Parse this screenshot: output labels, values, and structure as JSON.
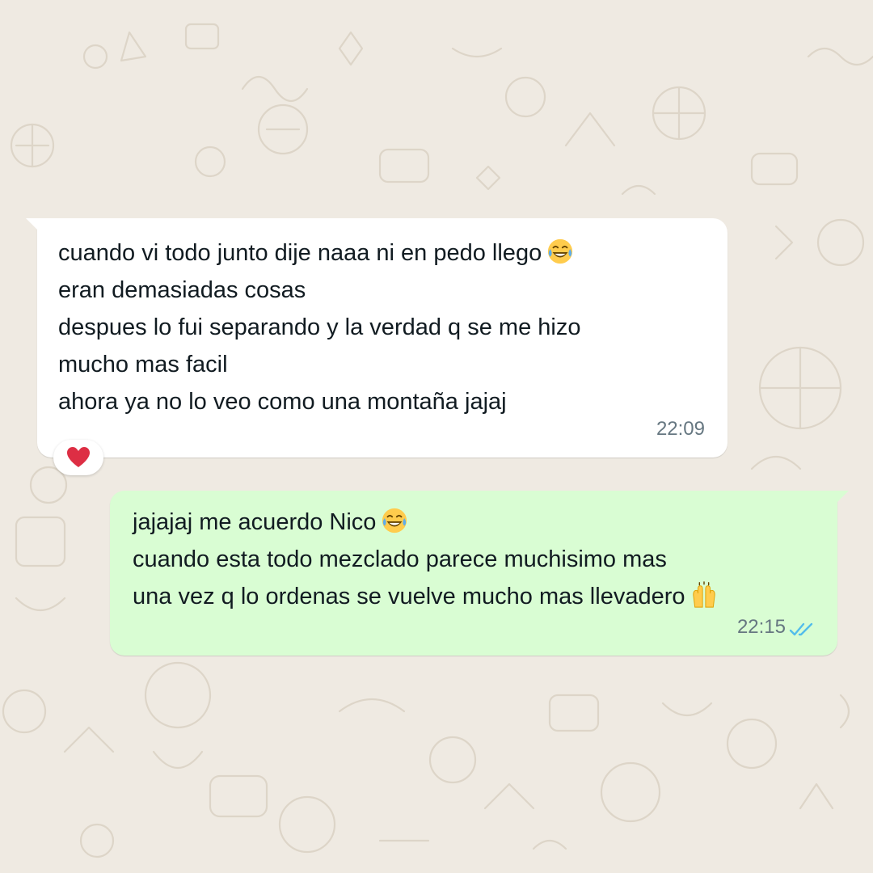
{
  "conversation": {
    "incoming": {
      "lines": [
        "cuando vi todo junto dije naaa ni en pedo llego",
        "eran demasiadas cosas",
        "despues lo fui separando y la verdad q se me hizo",
        "mucho mas facil",
        "ahora ya no lo veo como una montaña jajaj"
      ],
      "time": "22:09",
      "reaction": "❤"
    },
    "outgoing": {
      "lines": [
        "jajajaj me acuerdo Nico",
        "cuando esta todo mezclado parece muchisimo mas",
        "una vez q lo ordenas se vuelve mucho mas llevadero"
      ],
      "time": "22:15",
      "status_icon": "double-check-read-icon"
    }
  },
  "icons": {
    "laugh": "face-with-tears-of-joy-icon",
    "celebrate": "raising-hands-icon",
    "reaction": "red-heart-icon"
  },
  "colors": {
    "background": "#efeae2",
    "incoming_bubble": "#ffffff",
    "outgoing_bubble": "#d9fdd3",
    "read_ticks": "#53bdeb",
    "time_text": "#667781",
    "heart": "#e0243a"
  }
}
